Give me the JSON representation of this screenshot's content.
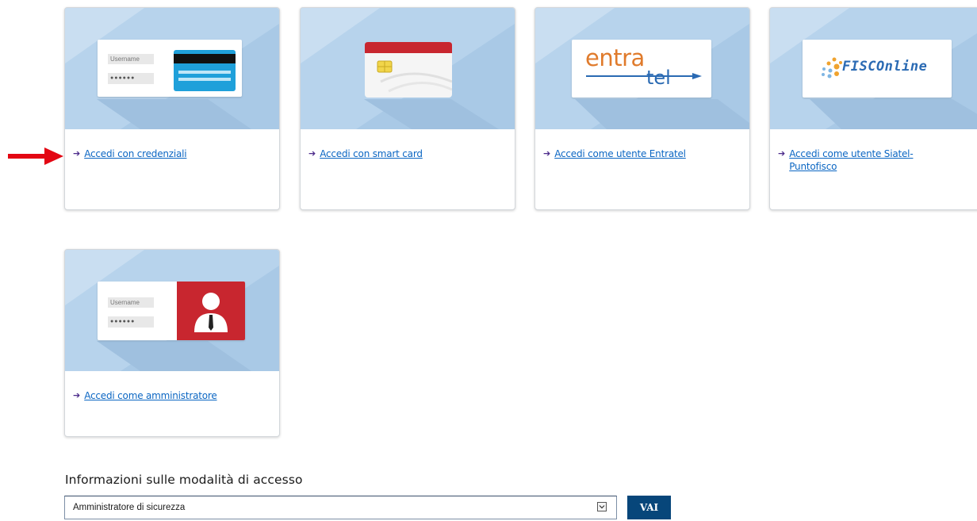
{
  "cards": [
    {
      "link_text": "Accedi con credenziali",
      "image": "credentials-card-icon"
    },
    {
      "link_text": "Accedi con smart card",
      "image": "smart-card-icon"
    },
    {
      "link_text": "Accedi come utente Entratel",
      "image": "entratel-logo"
    },
    {
      "link_text_line1": "Accedi come utente Siatel-",
      "link_text_line2": "Puntofisco",
      "image": "fisconline-logo"
    },
    {
      "link_text": "Accedi come amministratore",
      "image": "administrator-card-icon"
    }
  ],
  "illustrations": {
    "username_label": "Username",
    "password_mask": "●●●●●●",
    "entratel_word1": "entra",
    "entratel_word2": "tel",
    "fisconline_word": "FISCOnline"
  },
  "access_info": {
    "title": "Informazioni sulle modalità di accesso",
    "select_value": "Amministratore di sicurezza",
    "go_button": "VAI"
  },
  "colors": {
    "link": "#0b66c3",
    "arrow": "#4b2a8a",
    "pointer_arrow": "#e30613",
    "card_image_bg": "#b7d3ec",
    "button_bg": "#07467a",
    "entratel_orange": "#e07b2c",
    "entratel_blue": "#2a6ab3",
    "admin_red": "#c8262f"
  }
}
